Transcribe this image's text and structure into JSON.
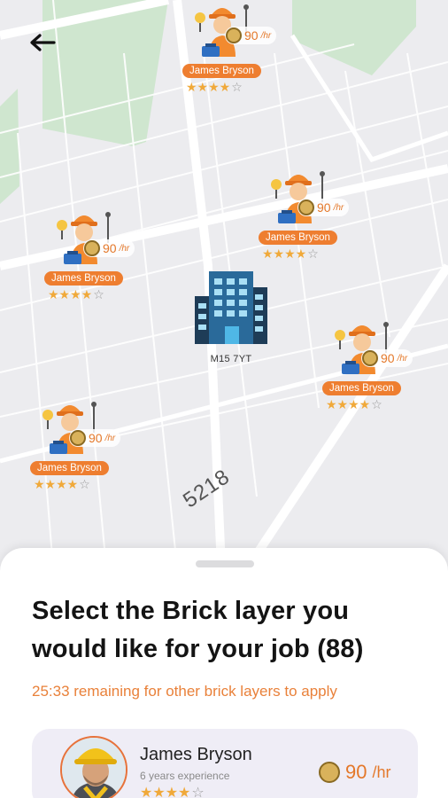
{
  "map": {
    "site_label": "M15 7YT",
    "road_label": "5218",
    "workers": [
      {
        "name": "James Bryson",
        "rate": "90",
        "unit": "/hr",
        "stars": "★★★★",
        "empty_stars": "☆"
      },
      {
        "name": "James Bryson",
        "rate": "90",
        "unit": "/hr",
        "stars": "★★★★",
        "empty_stars": "☆"
      },
      {
        "name": "James Bryson",
        "rate": "90",
        "unit": "/hr",
        "stars": "★★★★",
        "empty_stars": "☆"
      },
      {
        "name": "James Bryson",
        "rate": "90",
        "unit": "/hr",
        "stars": "★★★★",
        "empty_stars": "☆"
      },
      {
        "name": "James Bryson",
        "rate": "90",
        "unit": "/hr",
        "stars": "★★★★",
        "empty_stars": "☆"
      }
    ]
  },
  "sheet": {
    "title": "Select the Brick layer you would like for your job (88)",
    "timer_text": "25:33 remaining for other brick layers to apply",
    "card": {
      "name": "James Bryson",
      "experience": "6 years experience",
      "stars": "★★★★",
      "empty_stars": "☆",
      "rate": "90",
      "unit": "/hr"
    }
  },
  "colors": {
    "accent": "#ee7e30",
    "star": "#f0a93a",
    "map_bg": "#ececef",
    "park": "#cfe6cf"
  },
  "icons": {
    "back": "arrow-left-icon",
    "worker": "worker-avatar-icon",
    "building": "building-icon",
    "coin": "coin-icon",
    "star": "star-icon"
  }
}
